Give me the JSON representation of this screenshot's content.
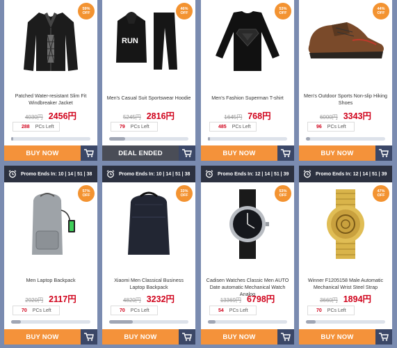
{
  "promo_prefix": "Promo Ends In:",
  "buy_label": "BUY NOW",
  "ended_label": "DEAL ENDED",
  "pcs_left_label": "PCs Left",
  "rows": [
    {
      "promo_time": "",
      "items": [
        {
          "icon": "jacket-image",
          "discount": "59%",
          "off": "OFF",
          "title": "Patched Water-resistant Slim Fit Windbreaker Jacket",
          "old": "4030円",
          "new": "2456円",
          "left": "288",
          "progress": 0.03,
          "button": "buy"
        },
        {
          "icon": "hoodie-suit-image",
          "discount": "46%",
          "off": "OFF",
          "title": "Men's Casual Suit Sportswear Hoodie",
          "old": "5245円",
          "new": "2816円",
          "left": "79",
          "progress": 0.2,
          "button": "ended"
        },
        {
          "icon": "superman-tshirt-image",
          "discount": "53%",
          "off": "OFF",
          "title": "Men's Fashion Superman T-shirt",
          "old": "1645円",
          "new": "768円",
          "left": "485",
          "progress": 0.03,
          "button": "buy"
        },
        {
          "icon": "hiking-shoe-image",
          "discount": "44%",
          "off": "OFF",
          "title": "Men's Outdoor Sports Non-slip Hiking Shoes",
          "old": "6000円",
          "new": "3343円",
          "left": "96",
          "progress": 0.05,
          "button": "buy"
        }
      ]
    },
    {
      "promo_time": "10 | 14 | 51 | 38",
      "items": [
        {
          "icon": "laptop-backpack-image",
          "discount": "57%",
          "off": "OFF",
          "title": "Men Laptop Backpack",
          "old": "2920円",
          "new": "2117円",
          "left": "70",
          "progress": 0.12,
          "button": "buy"
        },
        {
          "icon": "business-backpack-image",
          "discount": "33%",
          "off": "OFF",
          "title": "Xiaomi Men Classical Business Laptop Backpack",
          "old": "4820円",
          "new": "3232円",
          "left": "70",
          "progress": 0.3,
          "button": "buy"
        },
        {
          "icon": "wrist-watch-image",
          "discount": "53%",
          "off": "OFF",
          "title": "Cadisen Watches Classic Men AUTO Date automatic Mechanical Watch Analog",
          "old": "13369円",
          "new": "6798円",
          "left": "54",
          "progress": 0.1,
          "button": "buy"
        },
        {
          "icon": "gold-watch-image",
          "discount": "47%",
          "off": "OFF",
          "title": "Winner F1205158 Male Automatic Mechanical Wrist Steel Strap",
          "old": "3660円",
          "new": "1894円",
          "left": "70",
          "progress": 0.12,
          "button": "buy"
        }
      ]
    }
  ],
  "row2_times": [
    "10 | 14 | 51 | 38",
    "10 | 14 | 51 | 38",
    "12 | 14 | 51 | 39",
    "12 | 14 | 51 | 39"
  ]
}
